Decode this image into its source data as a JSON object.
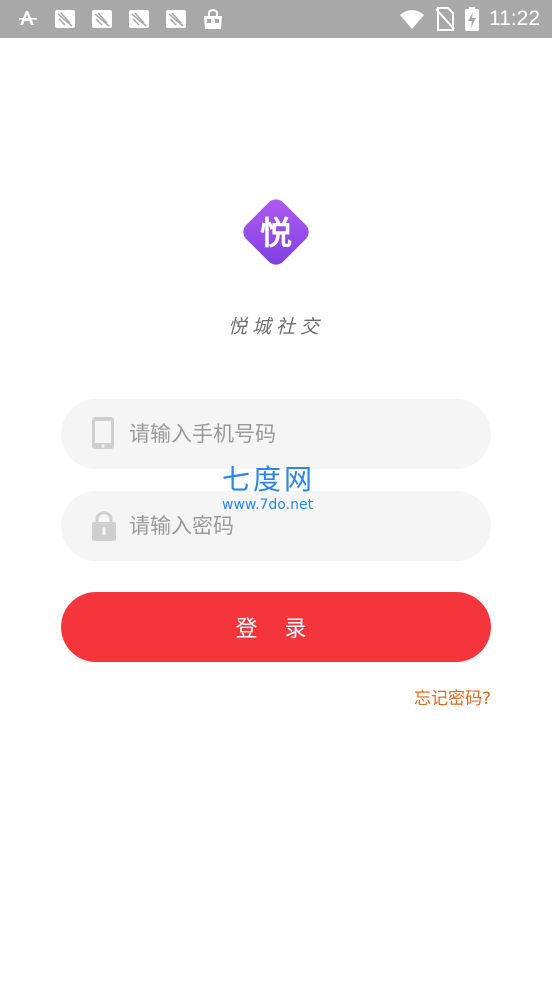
{
  "status_bar": {
    "time": "11:22",
    "left_icons": [
      "font-icon",
      "notification-app-icon",
      "notification-app-icon",
      "notification-app-icon",
      "notification-app-icon",
      "shopping-bag-icon"
    ],
    "right_icons": [
      "wifi-icon",
      "no-sim-icon",
      "battery-charging-icon"
    ]
  },
  "app": {
    "logo_char": "悦",
    "name": "悦城社交",
    "brand_colors": [
      "#b25cf0",
      "#7b3fe4"
    ]
  },
  "form": {
    "phone_placeholder": "请输入手机号码",
    "password_placeholder": "请输入密码",
    "login_label": "登 录",
    "forgot_label": "忘记密码?"
  },
  "watermark": {
    "name": "七度网",
    "url": "www.7do.net"
  },
  "colors": {
    "accent": "#f5353c",
    "forgot_link": "#e06a1c",
    "status_bar": "#a8a8a8"
  }
}
